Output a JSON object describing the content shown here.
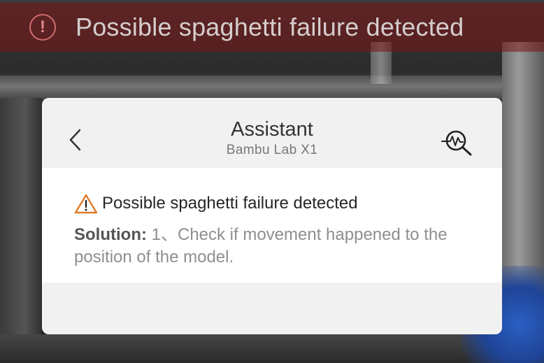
{
  "alert_banner": {
    "icon": "exclamation-circle-icon",
    "message": "Possible spaghetti failure detected"
  },
  "assistant": {
    "title": "Assistant",
    "subtitle": "Bambu Lab X1",
    "back_icon": "chevron-left-icon",
    "diagnose_icon": "magnifier-waveform-icon",
    "issue": {
      "icon": "warning-triangle-icon",
      "title": "Possible spaghetti failure detected",
      "solution_label": "Solution:",
      "solution_text": "1、Check if movement happened to the position of the model."
    }
  },
  "colors": {
    "banner_bg": "#781414",
    "card_bg": "#f1f1f1",
    "warning_orange": "#e07b2a"
  }
}
